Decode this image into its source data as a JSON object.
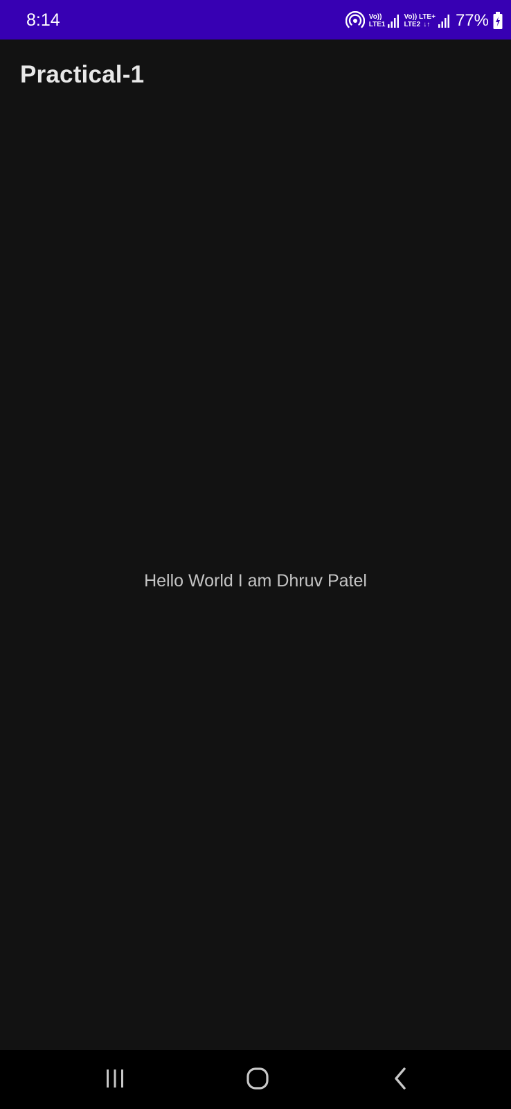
{
  "status_bar": {
    "time": "8:14",
    "sim1_top": "Vo))",
    "sim1_bottom": "LTE1",
    "sim2_top": "Vo)) LTE+",
    "sim2_bottom": "LTE2",
    "battery_percent": "77%",
    "background_color": "#3700b3",
    "icons": [
      "hotspot-icon",
      "signal-icon",
      "signal-icon",
      "battery-charging-icon"
    ]
  },
  "app": {
    "title": "Practical-1",
    "message": "Hello World I am Dhruv Patel",
    "background_color": "#121212"
  },
  "nav_bar": {
    "buttons": [
      "recents-icon",
      "home-icon",
      "back-icon"
    ]
  }
}
